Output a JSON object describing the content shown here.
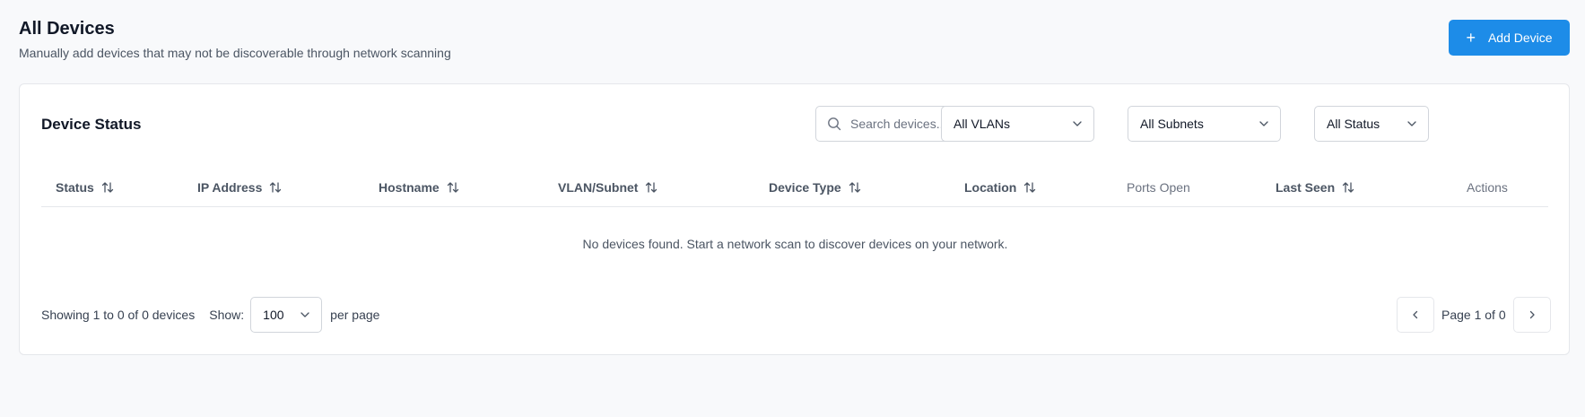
{
  "header": {
    "title": "All Devices",
    "subtitle": "Manually add devices that may not be discoverable through network scanning",
    "add_button_icon": "plus-icon",
    "add_button_label": "Add Device"
  },
  "card": {
    "title": "Device Status",
    "search": {
      "placeholder": "Search devices...",
      "value": "",
      "icon": "search-icon"
    },
    "filters": {
      "vlan": "All VLANs",
      "subnet": "All Subnets",
      "status": "All Status"
    }
  },
  "table": {
    "columns": [
      {
        "label": "Status",
        "sortable": true
      },
      {
        "label": "IP Address",
        "sortable": true
      },
      {
        "label": "Hostname",
        "sortable": true
      },
      {
        "label": "VLAN/Subnet",
        "sortable": true
      },
      {
        "label": "Device Type",
        "sortable": true
      },
      {
        "label": "Location",
        "sortable": true
      },
      {
        "label": "Ports Open",
        "sortable": false
      },
      {
        "label": "Last Seen",
        "sortable": true
      },
      {
        "label": "Actions",
        "sortable": false
      }
    ],
    "empty_message": "No devices found. Start a network scan to discover devices on your network."
  },
  "pagination": {
    "showing": "Showing 1 to 0 of 0 devices",
    "show_label": "Show:",
    "per_page_value": "100",
    "per_page_label": "per page",
    "page_info": "Page 1 of 0",
    "prev_icon": "chevron-left-icon",
    "next_icon": "chevron-right-icon"
  },
  "colors": {
    "accent": "#1d8ce8",
    "background": "#f8f9fb",
    "card": "#ffffff",
    "border": "#e5e7eb"
  }
}
